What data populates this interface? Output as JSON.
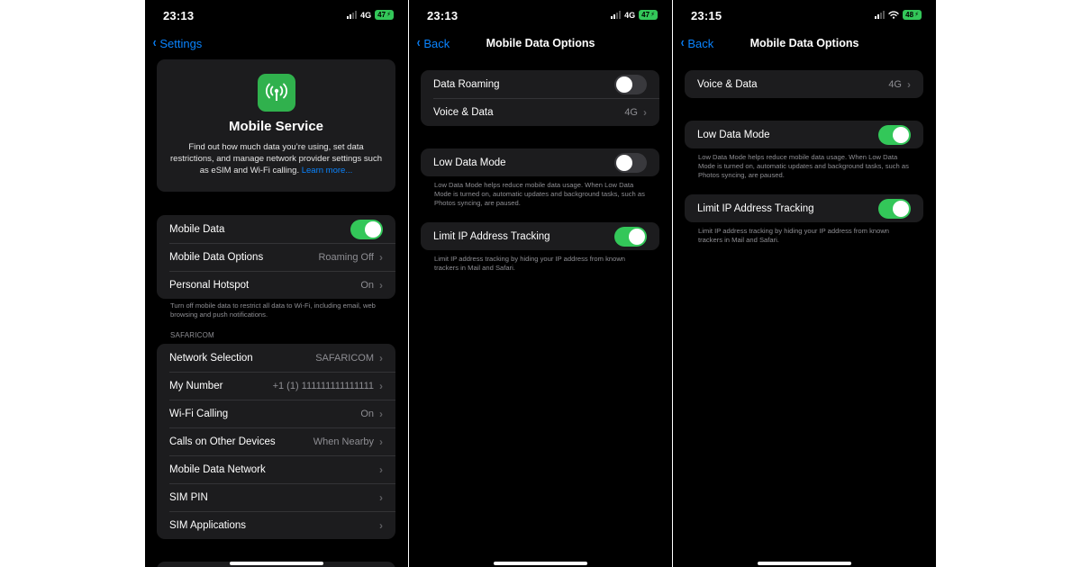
{
  "screen1": {
    "status": {
      "time": "23:13",
      "network": "4G",
      "battery": "47"
    },
    "nav": {
      "back_label": "Settings"
    },
    "hero": {
      "icon": "antenna-icon",
      "title": "Mobile Service",
      "text": "Find out how much data you’re using, set data restrictions, and manage network provider settings such as eSIM and Wi-Fi calling.",
      "link": "Learn more..."
    },
    "group1": [
      {
        "label": "Mobile Data",
        "toggle": true
      },
      {
        "label": "Mobile Data Options",
        "value": "Roaming Off"
      },
      {
        "label": "Personal Hotspot",
        "value": "On"
      }
    ],
    "group1_footer": "Turn off mobile data to restrict all data to Wi-Fi, including email, web browsing and push notifications.",
    "section_header": "SAFARICOM",
    "group2": [
      {
        "label": "Network Selection",
        "value": "SAFARICOM"
      },
      {
        "label": "My Number",
        "value": "+1 (1) 111111111111111"
      },
      {
        "label": "Wi-Fi Calling",
        "value": "On"
      },
      {
        "label": "Calls on Other Devices",
        "value": "When Nearby"
      },
      {
        "label": "Mobile Data Network",
        "value": ""
      },
      {
        "label": "SIM PIN",
        "value": ""
      },
      {
        "label": "SIM Applications",
        "value": ""
      }
    ]
  },
  "screen2": {
    "status": {
      "time": "23:13",
      "network": "4G",
      "battery": "47"
    },
    "nav": {
      "back_label": "Back",
      "title": "Mobile Data Options"
    },
    "group1": [
      {
        "label": "Data Roaming",
        "toggle": false
      },
      {
        "label": "Voice & Data",
        "value": "4G"
      }
    ],
    "low_data": {
      "label": "Low Data Mode",
      "toggle": false
    },
    "low_data_footer": "Low Data Mode helps reduce mobile data usage. When Low Data Mode is turned on, automatic updates and background tasks, such as Photos syncing, are paused.",
    "limit_ip": {
      "label": "Limit IP Address Tracking",
      "toggle": true
    },
    "limit_ip_footer": "Limit IP address tracking by hiding your IP address from known trackers in Mail and Safari."
  },
  "screen3": {
    "status": {
      "time": "23:15",
      "battery": "48"
    },
    "nav": {
      "back_label": "Back",
      "title": "Mobile Data Options"
    },
    "voice": {
      "label": "Voice & Data",
      "value": "4G"
    },
    "low_data": {
      "label": "Low Data Mode",
      "toggle": true
    },
    "low_data_footer": "Low Data Mode helps reduce mobile data usage. When Low Data Mode is turned on, automatic updates and background tasks, such as Photos syncing, are paused.",
    "limit_ip": {
      "label": "Limit IP Address Tracking",
      "toggle": true
    },
    "limit_ip_footer": "Limit IP address tracking by hiding your IP address from known trackers in Mail and Safari."
  },
  "colors": {
    "accent": "#0a84ff",
    "toggle_on": "#33c759",
    "group_bg": "#1c1c1e",
    "secondary_text": "#8e8e93"
  }
}
